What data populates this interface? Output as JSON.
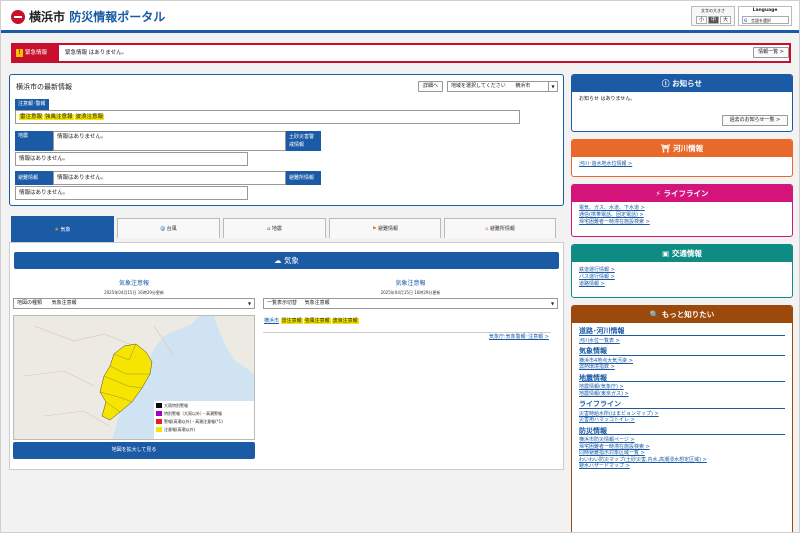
{
  "header": {
    "logo_main": "横浜市",
    "logo_sub": "防災情報ポータル",
    "font_size_label": "文字の大きさ",
    "font_sizes": [
      "小",
      "中",
      "大"
    ],
    "language_label": "Language",
    "language_select": "言語を選択"
  },
  "emergency": {
    "tag": "緊急情報",
    "message": "緊急情報 はありません。",
    "list_button": "情報一覧 >"
  },
  "latest": {
    "title": "横浜市の最新情報",
    "detail_button": "詳細へ",
    "region_placeholder": "地域を選択してください",
    "region_value": "横浜市",
    "warnings_tag": "注意報･警報",
    "warnings": [
      "雷注意報",
      "強風注意報",
      "波浪注意報"
    ],
    "quake_tag": "地震",
    "quake_text": "情報はありません。",
    "quake_text2": "情報はありません。",
    "landslide_tag": "土砂災害警戒情報",
    "evac_tag": "避難情報",
    "evac_text": "情報はありません。",
    "evac_text2": "情報はありません。",
    "shelter_tag": "避難所情報"
  },
  "tabs": [
    "気象",
    "台風",
    "地震",
    "避難情報",
    "避難所情報"
  ],
  "weather": {
    "bar_title": "気象",
    "left_title": "気象注意報",
    "left_date": "2025年04月15日 16時29分更新",
    "map_type_label": "地図の種類",
    "map_type_value": "気象注意報",
    "right_title": "気象注意報",
    "right_date": "2025年04月15日 16時29分更新",
    "list_label": "一覧表示切替",
    "list_value": "気象注意報",
    "city_link": "横浜市",
    "right_warnings": [
      "雷注意報",
      "強風注意報",
      "波浪注意報"
    ],
    "jma_link": "気象庁:気象警報･注意報 >",
    "map_button": "地図を拡大して見る",
    "legend": [
      {
        "label": "大雨特別警報",
        "color": "#0a0a0a"
      },
      {
        "label": "特別警報（大雨以外）・高潮警報",
        "color": "#a400c8"
      },
      {
        "label": "警報(高潮以外)・高潮注意報(*1)",
        "color": "#e81d1d"
      },
      {
        "label": "注意報(高潮以外)",
        "color": "#f5e500"
      }
    ],
    "map_region_color": "#f5e500"
  },
  "sidebar": {
    "notice": {
      "title": "お知らせ",
      "text": "お知らせ はありません。",
      "past_button": "過去のお知らせ一覧 >"
    },
    "river": {
      "title": "河川情報",
      "links": [
        "河川･遊水地水位情報 >"
      ]
    },
    "lifeline": {
      "title": "ライフライン",
      "links": [
        "電気、ガス、水道、下水道 >",
        "通信(携帯電話、固定電話) >",
        "帰宅困難者一時滞在施設検索 >"
      ]
    },
    "traffic": {
      "title": "交通情報",
      "links": [
        "鉄道運行情報 >",
        "バス運行情報 >",
        "道路情報 >"
      ]
    },
    "more": {
      "title": "もっと知りたい",
      "sections": [
        {
          "heading": "道路･河川情報",
          "links": [
            "河川水位一覧表 >"
          ]
        },
        {
          "heading": "気象情報",
          "links": [
            "横浜市4地点大気汚染 >",
            "濃熱環境指数 >"
          ]
        },
        {
          "heading": "地震情報",
          "links": [
            "地震情報(気象庁) >",
            "地震情報(東京ガス) >"
          ]
        },
        {
          "heading": "ライフライン",
          "links": [
            "災害時給水所(はまピョンマップ) >",
            "災害用ハマッコトイレ >"
          ]
        },
        {
          "heading": "防災情報",
          "links": [
            "横浜市防災情報ページ >",
            "帰宅困難者一時滞在施設検索 >",
            "同時避難指示対象区域一覧 >",
            "わいわい防災マップ(土砂災害,内水,高潮浸水想定区域) >",
            "避水ハザードマップ >"
          ]
        }
      ]
    },
    "colors": {
      "notice": "#1b5aa5",
      "river": "#e8692a",
      "lifeline": "#d4147a",
      "traffic": "#0e8c83",
      "more": "#9c4a0c"
    }
  }
}
